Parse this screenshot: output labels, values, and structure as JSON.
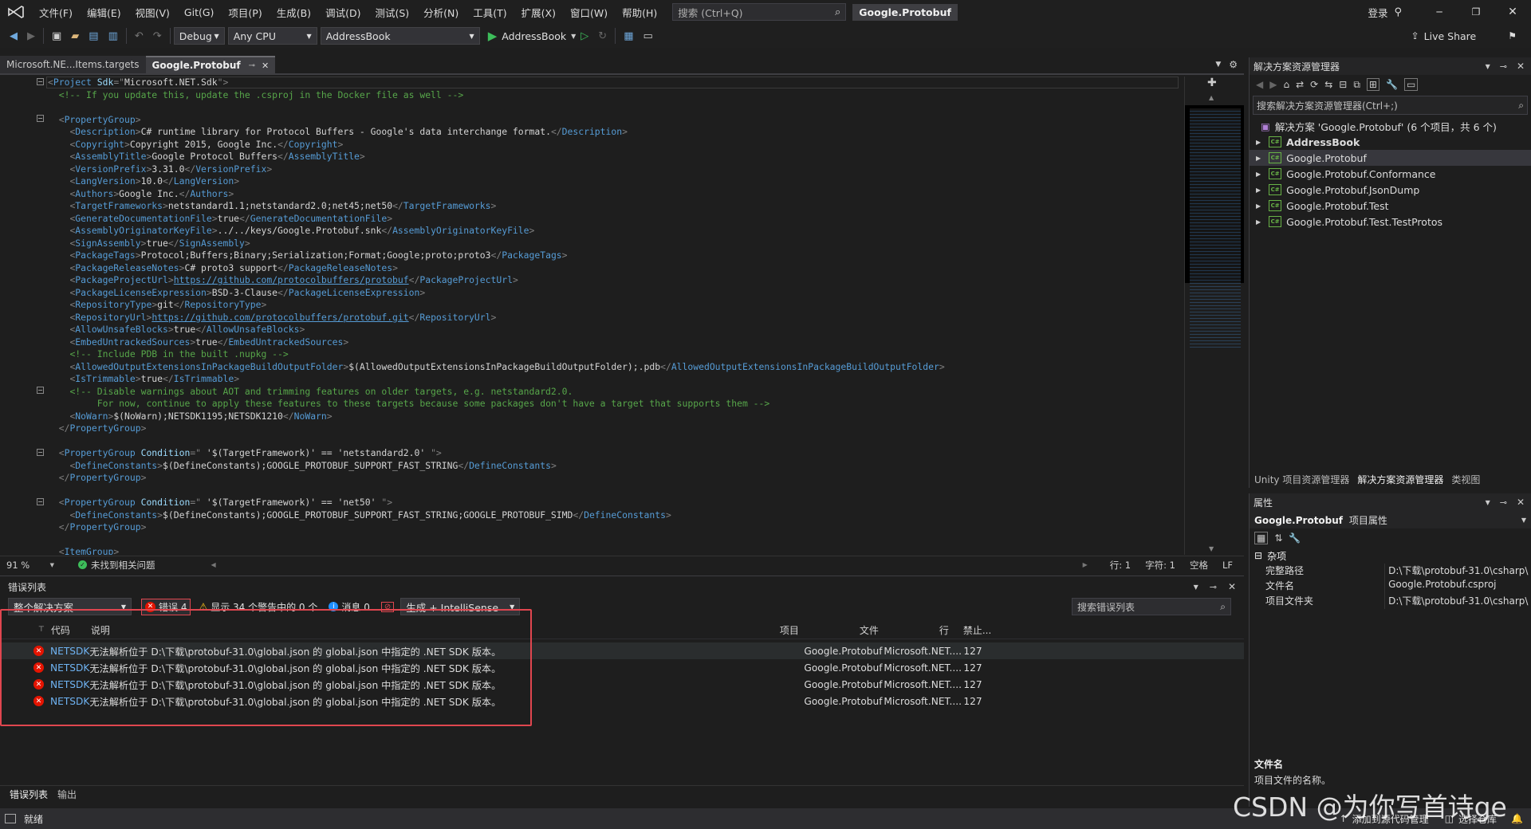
{
  "menubar": {
    "items": [
      "文件(F)",
      "编辑(E)",
      "视图(V)",
      "Git(G)",
      "项目(P)",
      "生成(B)",
      "调试(D)",
      "测试(S)",
      "分析(N)",
      "工具(T)",
      "扩展(X)",
      "窗口(W)",
      "帮助(H)"
    ],
    "search_placeholder": "搜索 (Ctrl+Q)",
    "solution_badge": "Google.Protobuf",
    "signin": "登录"
  },
  "toolbar": {
    "config": "Debug",
    "platform": "Any CPU",
    "startup_project": "AddressBook",
    "run_label": "AddressBook",
    "live_share": "Live Share"
  },
  "editor": {
    "tabs": [
      {
        "label": "Microsoft.NE...Items.targets",
        "active": false
      },
      {
        "label": "Google.Protobuf",
        "active": true
      }
    ],
    "lines": [
      [
        [
          "b",
          "<"
        ],
        [
          "t",
          "Project "
        ],
        [
          "a",
          "Sdk"
        ],
        [
          "b",
          "=\""
        ],
        [
          "v",
          "Microsoft.NET.Sdk"
        ],
        [
          "b",
          "\">"
        ]
      ],
      [
        [
          "s",
          "  "
        ],
        [
          "c",
          "<!-- If you update this, update the .csproj in the Docker file as well -->"
        ]
      ],
      [],
      [
        [
          "s",
          "  "
        ],
        [
          "b",
          "<"
        ],
        [
          "t",
          "PropertyGroup"
        ],
        [
          "b",
          ">"
        ]
      ],
      [
        [
          "s",
          "    "
        ],
        [
          "b",
          "<"
        ],
        [
          "t",
          "Description"
        ],
        [
          "b",
          ">"
        ],
        [
          "v",
          "C# runtime library for Protocol Buffers - Google's data interchange format."
        ],
        [
          "b",
          "</"
        ],
        [
          "t",
          "Description"
        ],
        [
          "b",
          ">"
        ]
      ],
      [
        [
          "s",
          "    "
        ],
        [
          "b",
          "<"
        ],
        [
          "t",
          "Copyright"
        ],
        [
          "b",
          ">"
        ],
        [
          "v",
          "Copyright 2015, Google Inc."
        ],
        [
          "b",
          "</"
        ],
        [
          "t",
          "Copyright"
        ],
        [
          "b",
          ">"
        ]
      ],
      [
        [
          "s",
          "    "
        ],
        [
          "b",
          "<"
        ],
        [
          "t",
          "AssemblyTitle"
        ],
        [
          "b",
          ">"
        ],
        [
          "v",
          "Google Protocol Buffers"
        ],
        [
          "b",
          "</"
        ],
        [
          "t",
          "AssemblyTitle"
        ],
        [
          "b",
          ">"
        ]
      ],
      [
        [
          "s",
          "    "
        ],
        [
          "b",
          "<"
        ],
        [
          "t",
          "VersionPrefix"
        ],
        [
          "b",
          ">"
        ],
        [
          "v",
          "3.31.0"
        ],
        [
          "b",
          "</"
        ],
        [
          "t",
          "VersionPrefix"
        ],
        [
          "b",
          ">"
        ]
      ],
      [
        [
          "s",
          "    "
        ],
        [
          "b",
          "<"
        ],
        [
          "t",
          "LangVersion"
        ],
        [
          "b",
          ">"
        ],
        [
          "v",
          "10.0"
        ],
        [
          "b",
          "</"
        ],
        [
          "t",
          "LangVersion"
        ],
        [
          "b",
          ">"
        ]
      ],
      [
        [
          "s",
          "    "
        ],
        [
          "b",
          "<"
        ],
        [
          "t",
          "Authors"
        ],
        [
          "b",
          ">"
        ],
        [
          "v",
          "Google Inc."
        ],
        [
          "b",
          "</"
        ],
        [
          "t",
          "Authors"
        ],
        [
          "b",
          ">"
        ]
      ],
      [
        [
          "s",
          "    "
        ],
        [
          "b",
          "<"
        ],
        [
          "t",
          "TargetFrameworks"
        ],
        [
          "b",
          ">"
        ],
        [
          "v",
          "netstandard1.1;netstandard2.0;net45;net50"
        ],
        [
          "b",
          "</"
        ],
        [
          "t",
          "TargetFrameworks"
        ],
        [
          "b",
          ">"
        ]
      ],
      [
        [
          "s",
          "    "
        ],
        [
          "b",
          "<"
        ],
        [
          "t",
          "GenerateDocumentationFile"
        ],
        [
          "b",
          ">"
        ],
        [
          "v",
          "true"
        ],
        [
          "b",
          "</"
        ],
        [
          "t",
          "GenerateDocumentationFile"
        ],
        [
          "b",
          ">"
        ]
      ],
      [
        [
          "s",
          "    "
        ],
        [
          "b",
          "<"
        ],
        [
          "t",
          "AssemblyOriginatorKeyFile"
        ],
        [
          "b",
          ">"
        ],
        [
          "v",
          "../../keys/Google.Protobuf.snk"
        ],
        [
          "b",
          "</"
        ],
        [
          "t",
          "AssemblyOriginatorKeyFile"
        ],
        [
          "b",
          ">"
        ]
      ],
      [
        [
          "s",
          "    "
        ],
        [
          "b",
          "<"
        ],
        [
          "t",
          "SignAssembly"
        ],
        [
          "b",
          ">"
        ],
        [
          "v",
          "true"
        ],
        [
          "b",
          "</"
        ],
        [
          "t",
          "SignAssembly"
        ],
        [
          "b",
          ">"
        ]
      ],
      [
        [
          "s",
          "    "
        ],
        [
          "b",
          "<"
        ],
        [
          "t",
          "PackageTags"
        ],
        [
          "b",
          ">"
        ],
        [
          "v",
          "Protocol;Buffers;Binary;Serialization;Format;Google;proto;proto3"
        ],
        [
          "b",
          "</"
        ],
        [
          "t",
          "PackageTags"
        ],
        [
          "b",
          ">"
        ]
      ],
      [
        [
          "s",
          "    "
        ],
        [
          "b",
          "<"
        ],
        [
          "t",
          "PackageReleaseNotes"
        ],
        [
          "b",
          ">"
        ],
        [
          "v",
          "C# proto3 support"
        ],
        [
          "b",
          "</"
        ],
        [
          "t",
          "PackageReleaseNotes"
        ],
        [
          "b",
          ">"
        ]
      ],
      [
        [
          "s",
          "    "
        ],
        [
          "b",
          "<"
        ],
        [
          "t",
          "PackageProjectUrl"
        ],
        [
          "b",
          ">"
        ],
        [
          "l",
          "https://github.com/protocolbuffers/protobuf"
        ],
        [
          "b",
          "</"
        ],
        [
          "t",
          "PackageProjectUrl"
        ],
        [
          "b",
          ">"
        ]
      ],
      [
        [
          "s",
          "    "
        ],
        [
          "b",
          "<"
        ],
        [
          "t",
          "PackageLicenseExpression"
        ],
        [
          "b",
          ">"
        ],
        [
          "v",
          "BSD-3-Clause"
        ],
        [
          "b",
          "</"
        ],
        [
          "t",
          "PackageLicenseExpression"
        ],
        [
          "b",
          ">"
        ]
      ],
      [
        [
          "s",
          "    "
        ],
        [
          "b",
          "<"
        ],
        [
          "t",
          "RepositoryType"
        ],
        [
          "b",
          ">"
        ],
        [
          "v",
          "git"
        ],
        [
          "b",
          "</"
        ],
        [
          "t",
          "RepositoryType"
        ],
        [
          "b",
          ">"
        ]
      ],
      [
        [
          "s",
          "    "
        ],
        [
          "b",
          "<"
        ],
        [
          "t",
          "RepositoryUrl"
        ],
        [
          "b",
          ">"
        ],
        [
          "l",
          "https://github.com/protocolbuffers/protobuf.git"
        ],
        [
          "b",
          "</"
        ],
        [
          "t",
          "RepositoryUrl"
        ],
        [
          "b",
          ">"
        ]
      ],
      [
        [
          "s",
          "    "
        ],
        [
          "b",
          "<"
        ],
        [
          "t",
          "AllowUnsafeBlocks"
        ],
        [
          "b",
          ">"
        ],
        [
          "v",
          "true"
        ],
        [
          "b",
          "</"
        ],
        [
          "t",
          "AllowUnsafeBlocks"
        ],
        [
          "b",
          ">"
        ]
      ],
      [
        [
          "s",
          "    "
        ],
        [
          "b",
          "<"
        ],
        [
          "t",
          "EmbedUntrackedSources"
        ],
        [
          "b",
          ">"
        ],
        [
          "v",
          "true"
        ],
        [
          "b",
          "</"
        ],
        [
          "t",
          "EmbedUntrackedSources"
        ],
        [
          "b",
          ">"
        ]
      ],
      [
        [
          "s",
          "    "
        ],
        [
          "c",
          "<!-- Include PDB in the built .nupkg -->"
        ]
      ],
      [
        [
          "s",
          "    "
        ],
        [
          "b",
          "<"
        ],
        [
          "t",
          "AllowedOutputExtensionsInPackageBuildOutputFolder"
        ],
        [
          "b",
          ">"
        ],
        [
          "v",
          "$(AllowedOutputExtensionsInPackageBuildOutputFolder);.pdb"
        ],
        [
          "b",
          "</"
        ],
        [
          "t",
          "AllowedOutputExtensionsInPackageBuildOutputFolder"
        ],
        [
          "b",
          ">"
        ]
      ],
      [
        [
          "s",
          "    "
        ],
        [
          "b",
          "<"
        ],
        [
          "t",
          "IsTrimmable"
        ],
        [
          "b",
          ">"
        ],
        [
          "v",
          "true"
        ],
        [
          "b",
          "</"
        ],
        [
          "t",
          "IsTrimmable"
        ],
        [
          "b",
          ">"
        ]
      ],
      [
        [
          "s",
          "    "
        ],
        [
          "c",
          "<!-- Disable warnings about AOT and trimming features on older targets, e.g. netstandard2.0."
        ]
      ],
      [
        [
          "s",
          "         "
        ],
        [
          "c",
          "For now, continue to apply these features to these targets because some packages don't have a target that supports them -->"
        ]
      ],
      [
        [
          "s",
          "    "
        ],
        [
          "b",
          "<"
        ],
        [
          "t",
          "NoWarn"
        ],
        [
          "b",
          ">"
        ],
        [
          "v",
          "$(NoWarn);NETSDK1195;NETSDK1210"
        ],
        [
          "b",
          "</"
        ],
        [
          "t",
          "NoWarn"
        ],
        [
          "b",
          ">"
        ]
      ],
      [
        [
          "s",
          "  "
        ],
        [
          "b",
          "</"
        ],
        [
          "t",
          "PropertyGroup"
        ],
        [
          "b",
          ">"
        ]
      ],
      [],
      [
        [
          "s",
          "  "
        ],
        [
          "b",
          "<"
        ],
        [
          "t",
          "PropertyGroup "
        ],
        [
          "a",
          "Condition"
        ],
        [
          "b",
          "=\""
        ],
        [
          "v",
          " '$(TargetFramework)' == 'netstandard2.0' "
        ],
        [
          "b",
          "\">"
        ]
      ],
      [
        [
          "s",
          "    "
        ],
        [
          "b",
          "<"
        ],
        [
          "t",
          "DefineConstants"
        ],
        [
          "b",
          ">"
        ],
        [
          "v",
          "$(DefineConstants);GOOGLE_PROTOBUF_SUPPORT_FAST_STRING"
        ],
        [
          "b",
          "</"
        ],
        [
          "t",
          "DefineConstants"
        ],
        [
          "b",
          ">"
        ]
      ],
      [
        [
          "s",
          "  "
        ],
        [
          "b",
          "</"
        ],
        [
          "t",
          "PropertyGroup"
        ],
        [
          "b",
          ">"
        ]
      ],
      [],
      [
        [
          "s",
          "  "
        ],
        [
          "b",
          "<"
        ],
        [
          "t",
          "PropertyGroup "
        ],
        [
          "a",
          "Condition"
        ],
        [
          "b",
          "=\""
        ],
        [
          "v",
          " '$(TargetFramework)' == 'net50' "
        ],
        [
          "b",
          "\">"
        ]
      ],
      [
        [
          "s",
          "    "
        ],
        [
          "b",
          "<"
        ],
        [
          "t",
          "DefineConstants"
        ],
        [
          "b",
          ">"
        ],
        [
          "v",
          "$(DefineConstants);GOOGLE_PROTOBUF_SUPPORT_FAST_STRING;GOOGLE_PROTOBUF_SIMD"
        ],
        [
          "b",
          "</"
        ],
        [
          "t",
          "DefineConstants"
        ],
        [
          "b",
          ">"
        ]
      ],
      [
        [
          "s",
          "  "
        ],
        [
          "b",
          "</"
        ],
        [
          "t",
          "PropertyGroup"
        ],
        [
          "b",
          ">"
        ]
      ],
      [],
      [
        [
          "s",
          "  "
        ],
        [
          "b",
          "<"
        ],
        [
          "t",
          "ItemGroup"
        ],
        [
          "b",
          ">"
        ]
      ]
    ],
    "status": {
      "zoom": "91 %",
      "issues": "未找到相关问题",
      "line": "行: 1",
      "char": "字符: 1",
      "spaces": "空格",
      "eol": "LF"
    }
  },
  "error_list": {
    "title": "错误列表",
    "scope": "整个解决方案",
    "errors_filter": "错误 4",
    "warnings_filter": "显示 34 个警告中的 0 个",
    "messages_filter": "消息 0",
    "build_filter": "生成 + IntelliSense",
    "search_placeholder": "搜索错误列表",
    "columns": {
      "code": "代码",
      "desc": "说明",
      "project": "项目",
      "file": "文件",
      "line": "行",
      "suppress": "禁止..."
    },
    "rows": [
      {
        "code": "NETSDK",
        "desc": "无法解析位于 D:\\下载\\protobuf-31.0\\global.json 的 global.json 中指定的 .NET SDK 版本。",
        "project": "Google.Protobuf",
        "file": "Microsoft.NET....",
        "line": "127"
      },
      {
        "code": "NETSDK",
        "desc": "无法解析位于 D:\\下载\\protobuf-31.0\\global.json 的 global.json 中指定的 .NET SDK 版本。",
        "project": "Google.Protobuf",
        "file": "Microsoft.NET....",
        "line": "127"
      },
      {
        "code": "NETSDK",
        "desc": "无法解析位于 D:\\下载\\protobuf-31.0\\global.json 的 global.json 中指定的 .NET SDK 版本。",
        "project": "Google.Protobuf",
        "file": "Microsoft.NET....",
        "line": "127"
      },
      {
        "code": "NETSDK",
        "desc": "无法解析位于 D:\\下载\\protobuf-31.0\\global.json 的 global.json 中指定的 .NET SDK 版本。",
        "project": "Google.Protobuf",
        "file": "Microsoft.NET....",
        "line": "127"
      }
    ],
    "bottom_tabs": [
      "错误列表",
      "输出"
    ],
    "highlight_color": "#e0464f"
  },
  "solution_explorer": {
    "title": "解决方案资源管理器",
    "search_placeholder": "搜索解决方案资源管理器(Ctrl+;)",
    "solution_label": "解决方案 'Google.Protobuf' (6 个项目，共 6 个)",
    "projects": [
      {
        "name": "AddressBook",
        "bold": true,
        "selected": false
      },
      {
        "name": "Google.Protobuf",
        "bold": false,
        "selected": true
      },
      {
        "name": "Google.Protobuf.Conformance",
        "bold": false,
        "selected": false
      },
      {
        "name": "Google.Protobuf.JsonDump",
        "bold": false,
        "selected": false
      },
      {
        "name": "Google.Protobuf.Test",
        "bold": false,
        "selected": false
      },
      {
        "name": "Google.Protobuf.Test.TestProtos",
        "bold": false,
        "selected": false
      }
    ],
    "bottom_tabs": [
      "Unity 项目资源管理器",
      "解决方案资源管理器",
      "类视图"
    ]
  },
  "properties": {
    "title": "属性",
    "object": "Google.Protobuf",
    "object_type": "项目属性",
    "category": "杂项",
    "rows": [
      {
        "name": "完整路径",
        "value": "D:\\下载\\protobuf-31.0\\csharp\\"
      },
      {
        "name": "文件名",
        "value": "Google.Protobuf.csproj"
      },
      {
        "name": "项目文件夹",
        "value": "D:\\下载\\protobuf-31.0\\csharp\\"
      }
    ],
    "desc_title": "文件名",
    "desc_text": "项目文件的名称。"
  },
  "statusbar": {
    "ready": "就绪",
    "add_source": "添加到源代码管理",
    "select_repo": "选择仓库",
    "watermark": "CSDN @为你写首诗ge"
  },
  "colors": {
    "accent": "#007acc",
    "error": "#e51400",
    "warning": "#fcc419",
    "info": "#1e90ff"
  }
}
